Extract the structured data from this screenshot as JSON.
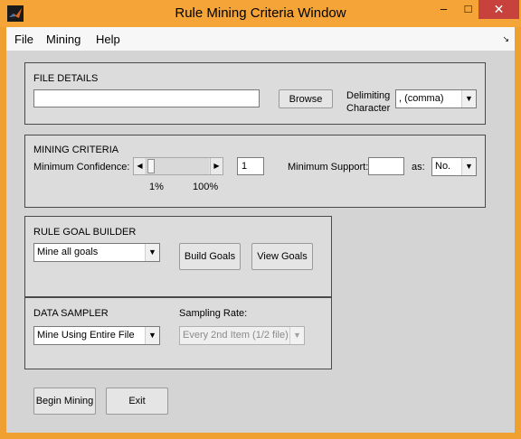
{
  "window": {
    "title": "Rule Mining Criteria Window"
  },
  "menubar": {
    "items": [
      "File",
      "Mining",
      "Help"
    ]
  },
  "file_details": {
    "title": "FILE DETAILS",
    "file_path_value": "",
    "browse_label": "Browse",
    "delimiting_label_line1": "Delimiting",
    "delimiting_label_line2": "Character",
    "delimiter_selected": ", (comma)"
  },
  "mining_criteria": {
    "title": "MINING CRITERIA",
    "min_confidence_label": "Minimum Confidence:",
    "confidence_slider_fraction": 0.0,
    "confidence_value": "1",
    "slider_min_label": "1%",
    "slider_max_label": "100%",
    "min_support_label": "Minimum Support:",
    "min_support_value": "",
    "as_label": "as:",
    "support_unit_selected": "No."
  },
  "rule_goal_builder": {
    "title": "RULE GOAL BUILDER",
    "goal_selected": "Mine all goals",
    "build_goals_label": "Build Goals",
    "view_goals_label": "View Goals"
  },
  "data_sampler": {
    "title": "DATA SAMPLER",
    "sampling_mode_selected": "Mine Using Entire File",
    "sampling_rate_label": "Sampling Rate:",
    "sampling_rate_selected": "Every 2nd Item (1/2 file)"
  },
  "actions": {
    "begin_mining_label": "Begin Mining",
    "exit_label": "Exit"
  }
}
